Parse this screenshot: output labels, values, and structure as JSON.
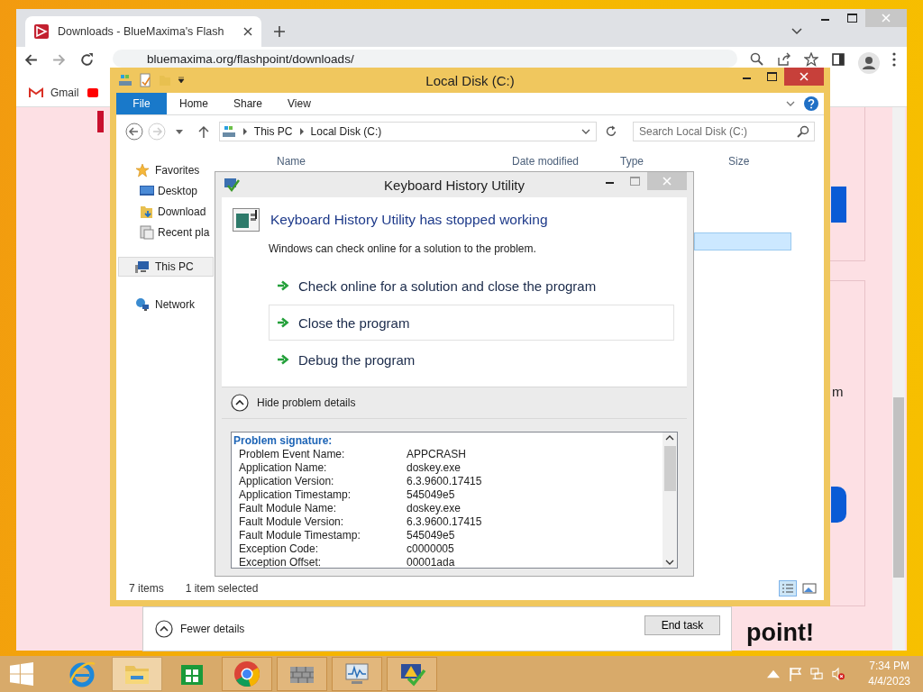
{
  "browser": {
    "tab_title": "Downloads - BlueMaxima's Flash",
    "address": "bluemaxima.org/flashpoint/downloads/",
    "bookmarks": [
      {
        "label": "Gmail",
        "kind": "gmail"
      }
    ],
    "page_fragments": [
      "m",
      "point!"
    ]
  },
  "task_manager": {
    "toggle": "Fewer details",
    "button": "End task"
  },
  "explorer": {
    "title": "Local Disk (C:)",
    "file_tab": "File",
    "tabs": [
      "Home",
      "Share",
      "View"
    ],
    "breadcrumb": [
      "This PC",
      "Local Disk (C:)"
    ],
    "search": {
      "placeholder": "Search Local Disk (C:)"
    },
    "columns": [
      "Name",
      "Date modified",
      "Type",
      "Size"
    ],
    "nav": [
      {
        "label": "Favorites",
        "kind": "star",
        "selected": false,
        "children": [
          {
            "label": "Desktop",
            "kind": "desktop",
            "selected": false
          },
          {
            "label": "Download",
            "kind": "downloads",
            "selected": false
          },
          {
            "label": "Recent pla",
            "kind": "recent",
            "selected": false
          }
        ]
      },
      {
        "label": "This PC",
        "kind": "pc",
        "selected": true
      },
      {
        "label": "Network",
        "kind": "network",
        "selected": false
      }
    ],
    "status": [
      "7 items",
      "1 item selected"
    ]
  },
  "dialog": {
    "title": "Keyboard History Utility",
    "heading": "Keyboard History Utility has stopped working",
    "message": "Windows can check online for a solution to the problem.",
    "options": [
      {
        "label": "Check online for a solution and close the program",
        "highlighted": false
      },
      {
        "label": "Close the program",
        "highlighted": true
      },
      {
        "label": "Debug the program",
        "highlighted": false
      }
    ],
    "details_toggle": "Hide problem details",
    "details_heading": "Problem signature:",
    "details": [
      {
        "name": "Problem Event Name:",
        "value": "APPCRASH"
      },
      {
        "name": "Application Name:",
        "value": "doskey.exe"
      },
      {
        "name": "Application Version:",
        "value": "6.3.9600.17415"
      },
      {
        "name": "Application Timestamp:",
        "value": "545049e5"
      },
      {
        "name": "Fault Module Name:",
        "value": "doskey.exe"
      },
      {
        "name": "Fault Module Version:",
        "value": "6.3.9600.17415"
      },
      {
        "name": "Fault Module Timestamp:",
        "value": "545049e5"
      },
      {
        "name": "Exception Code:",
        "value": "c0000005"
      },
      {
        "name": "Exception Offset:",
        "value": "00001ada"
      }
    ]
  },
  "taskbar": {
    "apps": [
      {
        "kind": "ie",
        "running": false,
        "selected": false
      },
      {
        "kind": "explorer",
        "running": true,
        "selected": true
      },
      {
        "kind": "store",
        "running": false,
        "selected": false
      },
      {
        "kind": "chrome",
        "running": true,
        "selected": false
      },
      {
        "kind": "bricks",
        "running": true,
        "selected": false
      },
      {
        "kind": "monitor",
        "running": true,
        "selected": false
      },
      {
        "kind": "flag-pc",
        "running": true,
        "selected": false
      }
    ],
    "time": "7:34 PM",
    "date": "4/4/2023"
  }
}
